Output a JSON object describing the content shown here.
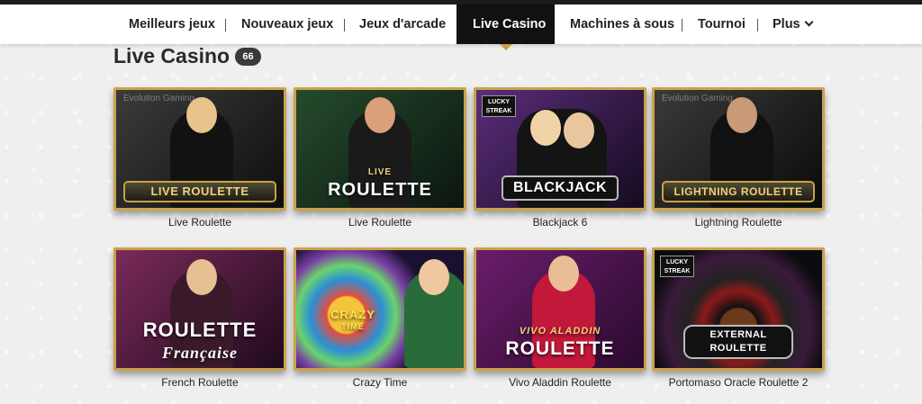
{
  "nav": {
    "items": [
      {
        "label": "Meilleurs jeux"
      },
      {
        "label": "Nouveaux jeux"
      },
      {
        "label": "Jeux d'arcade"
      },
      {
        "label": "Live Casino"
      },
      {
        "label": "Machines à sous"
      },
      {
        "label": "Tournoi"
      },
      {
        "label": "Plus"
      }
    ],
    "active": "Live Casino"
  },
  "page": {
    "title": "Live Casino",
    "count": "66"
  },
  "games": [
    {
      "name": "Live Roulette",
      "art_text": "LIVE ROULETTE",
      "watermark": "Evolution Gaming"
    },
    {
      "name": "Live Roulette",
      "art_text": "ROULETTE",
      "art_sub": "LIVE"
    },
    {
      "name": "Blackjack 6",
      "art_text": "BLACKJACK",
      "badge": "LUCKY STREAK"
    },
    {
      "name": "Lightning Roulette",
      "art_text": "LIGHTNING ROULETTE",
      "watermark": "Evolution Gaming"
    },
    {
      "name": "French Roulette",
      "art_text": "ROULETTE",
      "art_sub": "Française"
    },
    {
      "name": "Crazy Time",
      "art_text": "CRAZY",
      "art_sub": "TIME"
    },
    {
      "name": "Vivo Aladdin Roulette",
      "art_text": "ROULETTE",
      "art_sub": "VIVO ALADDIN"
    },
    {
      "name": "Portomaso Oracle Roulette 2",
      "art_text": "EXTERNAL ROULETTE",
      "badge": "LUCKY STREAK"
    }
  ],
  "colors": {
    "accent_gold": "#caa24b",
    "nav_active_bg": "#111111",
    "badge_bg": "#3a3a3a"
  }
}
